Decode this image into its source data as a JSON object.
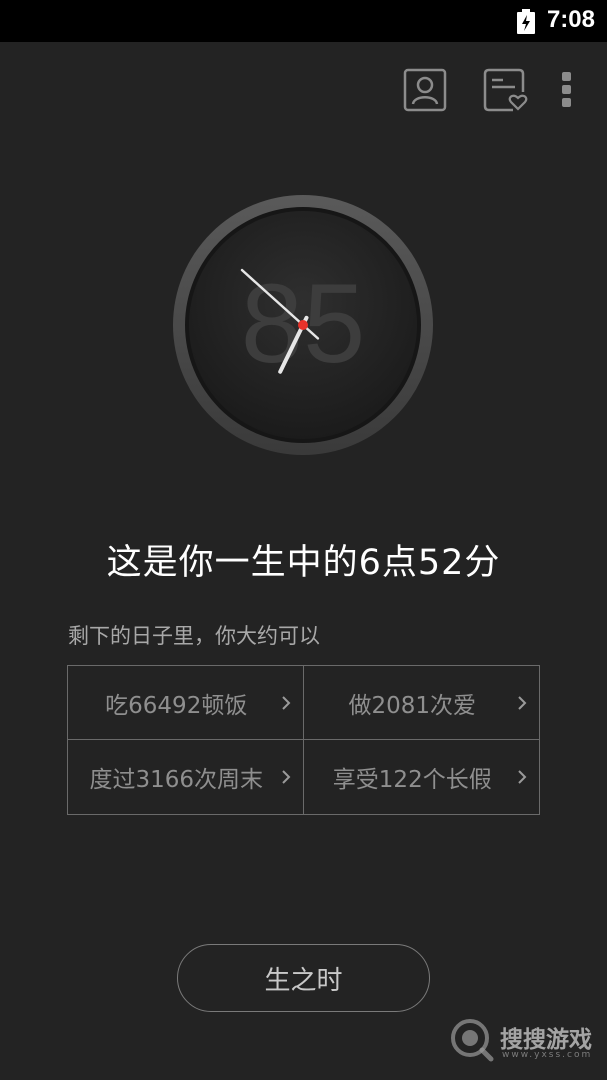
{
  "status_bar": {
    "time": "7:08",
    "battery_icon": "battery-charging-icon"
  },
  "toolbar": {
    "profile_icon": "person-profile-icon",
    "favorites_icon": "note-heart-icon",
    "more_icon": "more-vert-icon"
  },
  "clock": {
    "background_number": "85",
    "hour": 6,
    "minute": 52,
    "center_color": "#e8322a"
  },
  "headline": "这是你一生中的6点52分",
  "subtitle": "剩下的日子里，你大约可以",
  "stats": [
    {
      "label": "吃66492顿饭"
    },
    {
      "label": "做2081次爱"
    },
    {
      "label": "度过3166次周末"
    },
    {
      "label": "享受122个长假"
    }
  ],
  "main_button": "生之时",
  "watermark": {
    "text": "搜搜游戏",
    "sub": "www.yxss.com"
  },
  "colors": {
    "background": "#232323",
    "text": "#ffffff",
    "muted": "#8f8f8f",
    "accent_red": "#e8322a"
  }
}
